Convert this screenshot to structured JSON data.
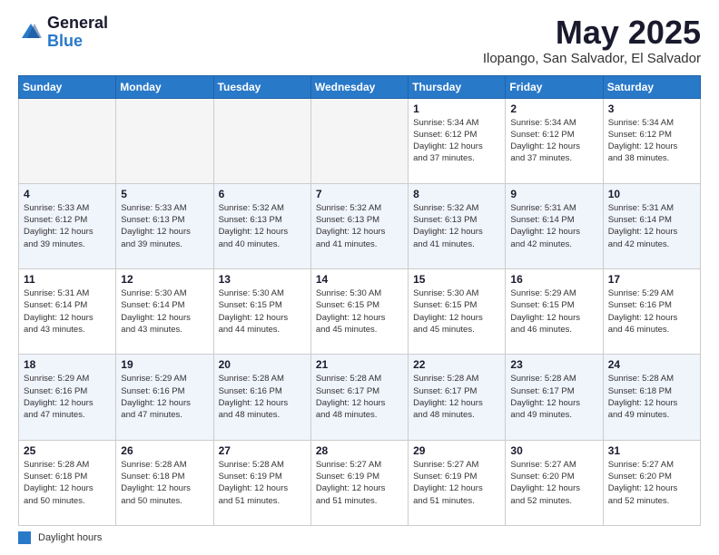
{
  "header": {
    "logo_general": "General",
    "logo_blue": "Blue",
    "month_title": "May 2025",
    "location": "Ilopango, San Salvador, El Salvador"
  },
  "calendar": {
    "days_of_week": [
      "Sunday",
      "Monday",
      "Tuesday",
      "Wednesday",
      "Thursday",
      "Friday",
      "Saturday"
    ],
    "weeks": [
      [
        {
          "day": "",
          "info": "",
          "empty": true
        },
        {
          "day": "",
          "info": "",
          "empty": true
        },
        {
          "day": "",
          "info": "",
          "empty": true
        },
        {
          "day": "",
          "info": "",
          "empty": true
        },
        {
          "day": "1",
          "info": "Sunrise: 5:34 AM\nSunset: 6:12 PM\nDaylight: 12 hours\nand 37 minutes.",
          "empty": false
        },
        {
          "day": "2",
          "info": "Sunrise: 5:34 AM\nSunset: 6:12 PM\nDaylight: 12 hours\nand 37 minutes.",
          "empty": false
        },
        {
          "day": "3",
          "info": "Sunrise: 5:34 AM\nSunset: 6:12 PM\nDaylight: 12 hours\nand 38 minutes.",
          "empty": false
        }
      ],
      [
        {
          "day": "4",
          "info": "Sunrise: 5:33 AM\nSunset: 6:12 PM\nDaylight: 12 hours\nand 39 minutes.",
          "empty": false
        },
        {
          "day": "5",
          "info": "Sunrise: 5:33 AM\nSunset: 6:13 PM\nDaylight: 12 hours\nand 39 minutes.",
          "empty": false
        },
        {
          "day": "6",
          "info": "Sunrise: 5:32 AM\nSunset: 6:13 PM\nDaylight: 12 hours\nand 40 minutes.",
          "empty": false
        },
        {
          "day": "7",
          "info": "Sunrise: 5:32 AM\nSunset: 6:13 PM\nDaylight: 12 hours\nand 41 minutes.",
          "empty": false
        },
        {
          "day": "8",
          "info": "Sunrise: 5:32 AM\nSunset: 6:13 PM\nDaylight: 12 hours\nand 41 minutes.",
          "empty": false
        },
        {
          "day": "9",
          "info": "Sunrise: 5:31 AM\nSunset: 6:14 PM\nDaylight: 12 hours\nand 42 minutes.",
          "empty": false
        },
        {
          "day": "10",
          "info": "Sunrise: 5:31 AM\nSunset: 6:14 PM\nDaylight: 12 hours\nand 42 minutes.",
          "empty": false
        }
      ],
      [
        {
          "day": "11",
          "info": "Sunrise: 5:31 AM\nSunset: 6:14 PM\nDaylight: 12 hours\nand 43 minutes.",
          "empty": false
        },
        {
          "day": "12",
          "info": "Sunrise: 5:30 AM\nSunset: 6:14 PM\nDaylight: 12 hours\nand 43 minutes.",
          "empty": false
        },
        {
          "day": "13",
          "info": "Sunrise: 5:30 AM\nSunset: 6:15 PM\nDaylight: 12 hours\nand 44 minutes.",
          "empty": false
        },
        {
          "day": "14",
          "info": "Sunrise: 5:30 AM\nSunset: 6:15 PM\nDaylight: 12 hours\nand 45 minutes.",
          "empty": false
        },
        {
          "day": "15",
          "info": "Sunrise: 5:30 AM\nSunset: 6:15 PM\nDaylight: 12 hours\nand 45 minutes.",
          "empty": false
        },
        {
          "day": "16",
          "info": "Sunrise: 5:29 AM\nSunset: 6:15 PM\nDaylight: 12 hours\nand 46 minutes.",
          "empty": false
        },
        {
          "day": "17",
          "info": "Sunrise: 5:29 AM\nSunset: 6:16 PM\nDaylight: 12 hours\nand 46 minutes.",
          "empty": false
        }
      ],
      [
        {
          "day": "18",
          "info": "Sunrise: 5:29 AM\nSunset: 6:16 PM\nDaylight: 12 hours\nand 47 minutes.",
          "empty": false
        },
        {
          "day": "19",
          "info": "Sunrise: 5:29 AM\nSunset: 6:16 PM\nDaylight: 12 hours\nand 47 minutes.",
          "empty": false
        },
        {
          "day": "20",
          "info": "Sunrise: 5:28 AM\nSunset: 6:16 PM\nDaylight: 12 hours\nand 48 minutes.",
          "empty": false
        },
        {
          "day": "21",
          "info": "Sunrise: 5:28 AM\nSunset: 6:17 PM\nDaylight: 12 hours\nand 48 minutes.",
          "empty": false
        },
        {
          "day": "22",
          "info": "Sunrise: 5:28 AM\nSunset: 6:17 PM\nDaylight: 12 hours\nand 48 minutes.",
          "empty": false
        },
        {
          "day": "23",
          "info": "Sunrise: 5:28 AM\nSunset: 6:17 PM\nDaylight: 12 hours\nand 49 minutes.",
          "empty": false
        },
        {
          "day": "24",
          "info": "Sunrise: 5:28 AM\nSunset: 6:18 PM\nDaylight: 12 hours\nand 49 minutes.",
          "empty": false
        }
      ],
      [
        {
          "day": "25",
          "info": "Sunrise: 5:28 AM\nSunset: 6:18 PM\nDaylight: 12 hours\nand 50 minutes.",
          "empty": false
        },
        {
          "day": "26",
          "info": "Sunrise: 5:28 AM\nSunset: 6:18 PM\nDaylight: 12 hours\nand 50 minutes.",
          "empty": false
        },
        {
          "day": "27",
          "info": "Sunrise: 5:28 AM\nSunset: 6:19 PM\nDaylight: 12 hours\nand 51 minutes.",
          "empty": false
        },
        {
          "day": "28",
          "info": "Sunrise: 5:27 AM\nSunset: 6:19 PM\nDaylight: 12 hours\nand 51 minutes.",
          "empty": false
        },
        {
          "day": "29",
          "info": "Sunrise: 5:27 AM\nSunset: 6:19 PM\nDaylight: 12 hours\nand 51 minutes.",
          "empty": false
        },
        {
          "day": "30",
          "info": "Sunrise: 5:27 AM\nSunset: 6:20 PM\nDaylight: 12 hours\nand 52 minutes.",
          "empty": false
        },
        {
          "day": "31",
          "info": "Sunrise: 5:27 AM\nSunset: 6:20 PM\nDaylight: 12 hours\nand 52 minutes.",
          "empty": false
        }
      ]
    ]
  },
  "legend": {
    "label": "Daylight hours"
  }
}
